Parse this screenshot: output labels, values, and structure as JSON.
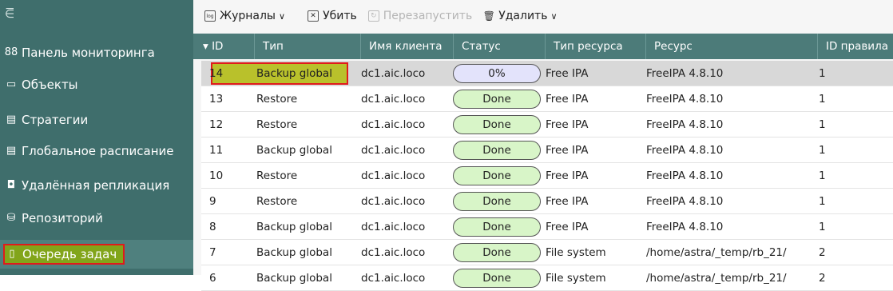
{
  "sidebar": {
    "collapse_glyph": "⋶",
    "items": [
      {
        "label": "Панель мониторинга",
        "icon": "dashboard-icon",
        "glyph": "88"
      },
      {
        "label": "Объекты",
        "icon": "monitor-icon",
        "glyph": "▭"
      },
      {
        "label": "Стратегии",
        "icon": "document-icon",
        "glyph": "▤"
      },
      {
        "label": "Глобальное расписание",
        "icon": "schedule-icon",
        "glyph": "▤"
      },
      {
        "label": "Удалённая репликация",
        "icon": "replication-icon",
        "glyph": "◘"
      },
      {
        "label": "Репозиторий",
        "icon": "database-icon",
        "glyph": "⛁"
      },
      {
        "label": "Очередь задач",
        "icon": "queue-icon",
        "glyph": "▯",
        "active": true
      }
    ]
  },
  "toolbar": {
    "logs_label": "Журналы",
    "logs_glyph": "log",
    "kill_label": "Убить",
    "kill_glyph": "✕",
    "restart_label": "Перезапустить",
    "restart_glyph": "↻",
    "delete_label": "Удалить",
    "delete_glyph": "🗑",
    "chevron": "∨"
  },
  "table": {
    "columns": [
      "▾ ID",
      "Тип",
      "Имя клиента",
      "Статус",
      "Тип ресурса",
      "Ресурс",
      "ID правила"
    ],
    "rows": [
      {
        "id": "14",
        "type": "Backup global",
        "client": "dc1.aic.loco",
        "status": "0%",
        "res_type": "Free IPA",
        "resource": "FreeIPA 4.8.10",
        "rule": "1",
        "selected": true
      },
      {
        "id": "13",
        "type": "Restore",
        "client": "dc1.aic.loco",
        "status": "Done",
        "res_type": "Free IPA",
        "resource": "FreeIPA 4.8.10",
        "rule": "1"
      },
      {
        "id": "12",
        "type": "Restore",
        "client": "dc1.aic.loco",
        "status": "Done",
        "res_type": "Free IPA",
        "resource": "FreeIPA 4.8.10",
        "rule": "1"
      },
      {
        "id": "11",
        "type": "Backup global",
        "client": "dc1.aic.loco",
        "status": "Done",
        "res_type": "Free IPA",
        "resource": "FreeIPA 4.8.10",
        "rule": "1"
      },
      {
        "id": "10",
        "type": "Restore",
        "client": "dc1.aic.loco",
        "status": "Done",
        "res_type": "Free IPA",
        "resource": "FreeIPA 4.8.10",
        "rule": "1"
      },
      {
        "id": "9",
        "type": "Restore",
        "client": "dc1.aic.loco",
        "status": "Done",
        "res_type": "Free IPA",
        "resource": "FreeIPA 4.8.10",
        "rule": "1"
      },
      {
        "id": "8",
        "type": "Backup global",
        "client": "dc1.aic.loco",
        "status": "Done",
        "res_type": "Free IPA",
        "resource": "FreeIPA 4.8.10",
        "rule": "1"
      },
      {
        "id": "7",
        "type": "Backup global",
        "client": "dc1.aic.loco",
        "status": "Done",
        "res_type": "File system",
        "resource": "/home/astra/_temp/rb_21/",
        "rule": "2"
      },
      {
        "id": "6",
        "type": "Backup global",
        "client": "dc1.aic.loco",
        "status": "Done",
        "res_type": "File system",
        "resource": "/home/astra/_temp/rb_21/",
        "rule": "2"
      }
    ]
  },
  "colors": {
    "sidebar_bg": "#3f6e6c",
    "header_bg": "#4c7b79",
    "highlight_border": "#e01b1b",
    "done_pill": "#d8f5c8",
    "running_pill": "#e3e3fb"
  }
}
